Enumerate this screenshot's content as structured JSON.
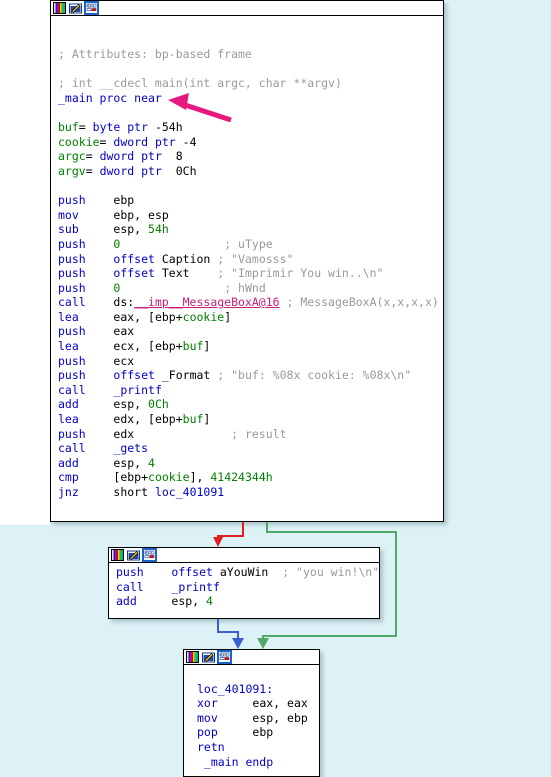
{
  "app": {
    "name": "IDA Pro graph view",
    "canvas_bg": "#ddf2f7",
    "node_bg": "#ffffff",
    "node_border": "#000000"
  },
  "colors": {
    "mnemonic": "#0000c8",
    "register": "#000000",
    "number": "#008000",
    "stack_var": "#008000",
    "comment": "#9a9a9a",
    "label": "#0000c8",
    "import_highlight": "#c81e78",
    "edge_false": "#e02020",
    "edge_true": "#4fa86a",
    "edge_flow": "#3a5fd0",
    "annotation_arrow": "#e6187e"
  },
  "titlebar_icons": [
    {
      "name": "color-palette-icon",
      "selected": false
    },
    {
      "name": "edit-pencil-icon",
      "selected": false
    },
    {
      "name": "graph-chart-icon",
      "selected": true
    }
  ],
  "nodes": [
    {
      "id": "node-main",
      "name": "basic-block-main",
      "lines": [
        [],
        [],
        [
          {
            "t": "; Attributes: bp-based frame",
            "c": "cmt"
          }
        ],
        [],
        [
          {
            "t": "; int __cdecl main(int argc, char **argv)",
            "c": "cmt"
          }
        ],
        [
          {
            "t": "_main proc near",
            "c": "mn"
          }
        ],
        [],
        [
          {
            "t": "buf",
            "c": "var"
          },
          {
            "t": "= ",
            "c": "rg"
          },
          {
            "t": "byte ptr ",
            "c": "mn"
          },
          {
            "t": "-54h",
            "c": "rg"
          }
        ],
        [
          {
            "t": "cookie",
            "c": "var"
          },
          {
            "t": "= ",
            "c": "rg"
          },
          {
            "t": "dword ptr ",
            "c": "mn"
          },
          {
            "t": "-4",
            "c": "rg"
          }
        ],
        [
          {
            "t": "argc",
            "c": "var"
          },
          {
            "t": "= ",
            "c": "rg"
          },
          {
            "t": "dword ptr ",
            "c": "mn"
          },
          {
            "t": " 8",
            "c": "rg"
          }
        ],
        [
          {
            "t": "argv",
            "c": "var"
          },
          {
            "t": "= ",
            "c": "rg"
          },
          {
            "t": "dword ptr ",
            "c": "mn"
          },
          {
            "t": " 0Ch",
            "c": "rg"
          }
        ],
        [],
        [
          {
            "t": "push",
            "c": "mn"
          },
          {
            "t": "    ebp",
            "c": "rg"
          }
        ],
        [
          {
            "t": "mov",
            "c": "mn"
          },
          {
            "t": "     ebp, esp",
            "c": "rg"
          }
        ],
        [
          {
            "t": "sub",
            "c": "mn"
          },
          {
            "t": "     esp, ",
            "c": "rg"
          },
          {
            "t": "54h",
            "c": "num"
          }
        ],
        [
          {
            "t": "push",
            "c": "mn"
          },
          {
            "t": "    ",
            "c": "rg"
          },
          {
            "t": "0",
            "c": "num"
          },
          {
            "t": "               ",
            "c": "pad"
          },
          {
            "t": "; uType",
            "c": "cmt"
          }
        ],
        [
          {
            "t": "push",
            "c": "mn"
          },
          {
            "t": "    ",
            "c": "rg"
          },
          {
            "t": "offset ",
            "c": "mn"
          },
          {
            "t": "Caption",
            "c": "rg"
          },
          {
            "t": " ",
            "c": "pad"
          },
          {
            "t": "; \"Vamosss\"",
            "c": "cmt"
          }
        ],
        [
          {
            "t": "push",
            "c": "mn"
          },
          {
            "t": "    ",
            "c": "rg"
          },
          {
            "t": "offset ",
            "c": "mn"
          },
          {
            "t": "Text",
            "c": "rg"
          },
          {
            "t": "    ",
            "c": "pad"
          },
          {
            "t": "; \"Imprimir You win..\\n\"",
            "c": "cmt"
          }
        ],
        [
          {
            "t": "push",
            "c": "mn"
          },
          {
            "t": "    ",
            "c": "rg"
          },
          {
            "t": "0",
            "c": "num"
          },
          {
            "t": "               ",
            "c": "pad"
          },
          {
            "t": "; hWnd",
            "c": "cmt"
          }
        ],
        [
          {
            "t": "call",
            "c": "mn"
          },
          {
            "t": "    ds:",
            "c": "rg"
          },
          {
            "t": "__imp__MessageBoxA@16",
            "c": "api-hi"
          },
          {
            "t": " ; MessageBoxA(x,x,x,x)",
            "c": "cmt"
          }
        ],
        [
          {
            "t": "lea",
            "c": "mn"
          },
          {
            "t": "     eax, [ebp+",
            "c": "rg"
          },
          {
            "t": "cookie",
            "c": "var"
          },
          {
            "t": "]",
            "c": "rg"
          }
        ],
        [
          {
            "t": "push",
            "c": "mn"
          },
          {
            "t": "    eax",
            "c": "rg"
          }
        ],
        [
          {
            "t": "lea",
            "c": "mn"
          },
          {
            "t": "     ecx, [ebp+",
            "c": "rg"
          },
          {
            "t": "buf",
            "c": "var"
          },
          {
            "t": "]",
            "c": "rg"
          }
        ],
        [
          {
            "t": "push",
            "c": "mn"
          },
          {
            "t": "    ecx",
            "c": "rg"
          }
        ],
        [
          {
            "t": "push",
            "c": "mn"
          },
          {
            "t": "    ",
            "c": "rg"
          },
          {
            "t": "offset ",
            "c": "mn"
          },
          {
            "t": "_Format",
            "c": "rg"
          },
          {
            "t": " ",
            "c": "pad"
          },
          {
            "t": "; \"buf: %08x cookie: %08x\\n\"",
            "c": "cmt"
          }
        ],
        [
          {
            "t": "call",
            "c": "mn"
          },
          {
            "t": "    ",
            "c": "rg"
          },
          {
            "t": "_printf",
            "c": "lbl"
          }
        ],
        [
          {
            "t": "add",
            "c": "mn"
          },
          {
            "t": "     esp, ",
            "c": "rg"
          },
          {
            "t": "0Ch",
            "c": "num"
          }
        ],
        [
          {
            "t": "lea",
            "c": "mn"
          },
          {
            "t": "     edx, [ebp+",
            "c": "rg"
          },
          {
            "t": "buf",
            "c": "var"
          },
          {
            "t": "]",
            "c": "rg"
          }
        ],
        [
          {
            "t": "push",
            "c": "mn"
          },
          {
            "t": "    edx",
            "c": "rg"
          },
          {
            "t": "              ",
            "c": "pad"
          },
          {
            "t": "; result",
            "c": "cmt"
          }
        ],
        [
          {
            "t": "call",
            "c": "mn"
          },
          {
            "t": "    ",
            "c": "rg"
          },
          {
            "t": "_gets",
            "c": "lbl"
          }
        ],
        [
          {
            "t": "add",
            "c": "mn"
          },
          {
            "t": "     esp, ",
            "c": "rg"
          },
          {
            "t": "4",
            "c": "num"
          }
        ],
        [
          {
            "t": "cmp",
            "c": "mn"
          },
          {
            "t": "     [ebp+",
            "c": "rg"
          },
          {
            "t": "cookie",
            "c": "var"
          },
          {
            "t": "], ",
            "c": "rg"
          },
          {
            "t": "41424344h",
            "c": "num"
          }
        ],
        [
          {
            "t": "jnz",
            "c": "mn"
          },
          {
            "t": "     short ",
            "c": "rg"
          },
          {
            "t": "loc_401091",
            "c": "lbl"
          }
        ]
      ]
    },
    {
      "id": "node-youwin",
      "name": "basic-block-you-win",
      "lines": [
        [
          {
            "t": "push",
            "c": "mn"
          },
          {
            "t": "    ",
            "c": "rg"
          },
          {
            "t": "offset ",
            "c": "mn"
          },
          {
            "t": "aYouWin",
            "c": "rg"
          },
          {
            "t": "  ",
            "c": "pad"
          },
          {
            "t": "; \"you win!\\n\"",
            "c": "cmt"
          }
        ],
        [
          {
            "t": "call",
            "c": "mn"
          },
          {
            "t": "    ",
            "c": "rg"
          },
          {
            "t": "_printf",
            "c": "lbl"
          }
        ],
        [
          {
            "t": "add",
            "c": "mn"
          },
          {
            "t": "     esp, ",
            "c": "rg"
          },
          {
            "t": "4",
            "c": "num"
          }
        ]
      ]
    },
    {
      "id": "node-loc401091",
      "name": "basic-block-loc-401091",
      "lines": [
        [],
        [
          {
            "t": "loc_401091:",
            "c": "lbl"
          }
        ],
        [
          {
            "t": "xor",
            "c": "mn"
          },
          {
            "t": "     eax, eax",
            "c": "rg"
          }
        ],
        [
          {
            "t": "mov",
            "c": "mn"
          },
          {
            "t": "     esp, ebp",
            "c": "rg"
          }
        ],
        [
          {
            "t": "pop",
            "c": "mn"
          },
          {
            "t": "     ebp",
            "c": "rg"
          }
        ],
        [
          {
            "t": "retn",
            "c": "mn"
          }
        ],
        [
          {
            "t": " _main endp",
            "c": "mn"
          }
        ]
      ]
    }
  ],
  "edges": [
    {
      "name": "edge-false-branch-to-you-win",
      "color": "#e02020",
      "kind": "false"
    },
    {
      "name": "edge-true-branch-to-loc-401091",
      "color": "#4fa86a",
      "kind": "true"
    },
    {
      "name": "edge-flow-you-win-to-loc-401091",
      "color": "#3a5fd0",
      "kind": "flow"
    }
  ],
  "annotation": {
    "name": "pink-pointer-arrow",
    "color": "#e6187e",
    "points_at": "_main proc near"
  }
}
